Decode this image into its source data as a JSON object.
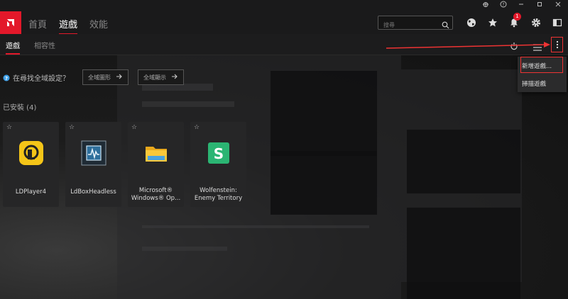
{
  "header": {
    "tabs": [
      {
        "label": "首頁",
        "active": false
      },
      {
        "label": "遊戲",
        "active": true
      },
      {
        "label": "效能",
        "active": false
      }
    ],
    "search": {
      "placeholder": "搜尋"
    },
    "notifications_count": "1",
    "brand_color": "#e3182a"
  },
  "subnav": {
    "tabs": [
      {
        "label": "遊戲",
        "active": true
      },
      {
        "label": "相容性",
        "active": false
      }
    ]
  },
  "global_settings": {
    "question": "在尋找全域設定？",
    "graphics_button": "全域圖形",
    "display_button": "全域顯示"
  },
  "installed": {
    "heading": "已安裝 (4)",
    "games": [
      {
        "name": "LDPlayer4",
        "icon": "ldplayer-icon"
      },
      {
        "name": "LdBoxHeadless",
        "icon": "ldbox-icon"
      },
      {
        "name": "Microsoft® Windows® Op...",
        "icon": "folder-icon"
      },
      {
        "name": "Wolfenstein: Enemy Territory",
        "icon": "wolfenstein-icon"
      }
    ]
  },
  "dropdown": {
    "items": [
      "新增遊戲...",
      "掃描遊戲"
    ]
  },
  "annotation_color": "#e33333"
}
